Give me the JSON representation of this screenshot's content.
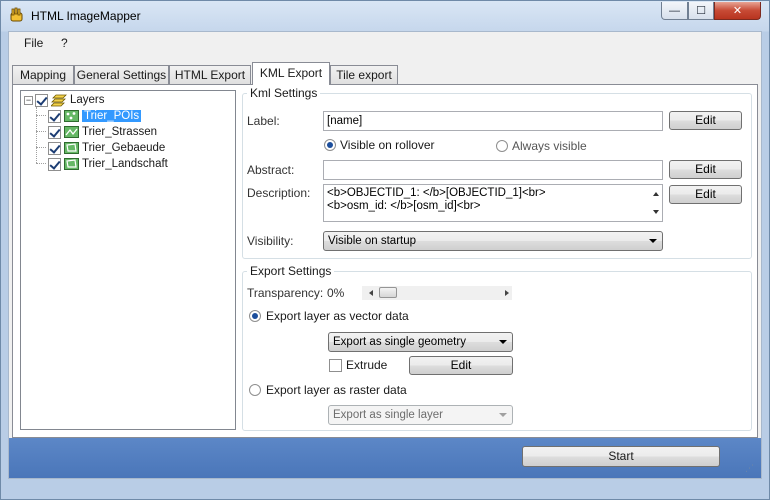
{
  "window": {
    "title": "HTML ImageMapper",
    "min_symbol": "—",
    "max_symbol": "☐",
    "close_symbol": "✕"
  },
  "menu": [
    {
      "label": "File"
    },
    {
      "label": "?"
    }
  ],
  "tabs": [
    {
      "label": "Mapping",
      "active": false
    },
    {
      "label": "General Settings",
      "active": false
    },
    {
      "label": "HTML Export",
      "active": false
    },
    {
      "label": "KML Export",
      "active": true
    },
    {
      "label": "Tile export",
      "active": false
    }
  ],
  "tree": {
    "root": {
      "label": "Layers",
      "checked": true,
      "expander": "−"
    },
    "items": [
      {
        "label": "Trier_POIs",
        "checked": true,
        "selected": true,
        "icon": "point-layer-icon"
      },
      {
        "label": "Trier_Strassen",
        "checked": true,
        "selected": false,
        "icon": "line-layer-icon"
      },
      {
        "label": "Trier_Gebaeude",
        "checked": true,
        "selected": false,
        "icon": "polygon-layer-icon"
      },
      {
        "label": "Trier_Landschaft",
        "checked": true,
        "selected": false,
        "icon": "polygon-layer-icon"
      }
    ]
  },
  "kml": {
    "group_title": "Kml Settings",
    "label_label": "Label:",
    "label_value": "[name]",
    "edit_label": "Edit",
    "radio_rollover": "Visible on rollover",
    "radio_always": "Always visible",
    "rollover_selected": true,
    "abstract_label": "Abstract:",
    "abstract_value": "",
    "description_label": "Description:",
    "description_line1": "<b>OBJECTID_1: </b>[OBJECTID_1]<br>",
    "description_line2": "<b>osm_id: </b>[osm_id]<br>",
    "visibility_label": "Visibility:",
    "visibility_value": "Visible on startup"
  },
  "export": {
    "group_title": "Export Settings",
    "transparency_label": "Transparency:",
    "transparency_value": "0%",
    "transparency_level": 0,
    "vector_label": "Export layer as vector data",
    "vector_selected": true,
    "vector_mode": "Export as single geometry",
    "extrude_label": "Extrude",
    "extrude_checked": false,
    "edit_label": "Edit",
    "raster_label": "Export layer as raster data",
    "raster_selected": false,
    "raster_mode": "Export as single layer"
  },
  "footer": {
    "start_label": "Start",
    "grip": "⋰"
  }
}
